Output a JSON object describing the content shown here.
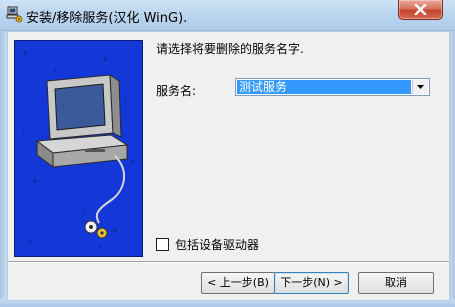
{
  "window": {
    "title": "安装/移除服务(汉化 WinG)."
  },
  "dialog": {
    "prompt": "请选择将要删除的服务名字.",
    "service_label": "服务名:",
    "service_value": "测试服务",
    "checkbox_label": "包括设备驱动器",
    "checkbox_checked": false
  },
  "buttons": {
    "back": "< 上一步(B)",
    "next": "下一步(N) >",
    "cancel": "取消"
  },
  "icons": {
    "app": "computer-setup-icon",
    "close": "close-icon",
    "dropdown": "chevron-down-icon"
  },
  "colors": {
    "picture_background": "#1437d8",
    "selection": "#3399ff",
    "close_button": "#c4442b"
  }
}
